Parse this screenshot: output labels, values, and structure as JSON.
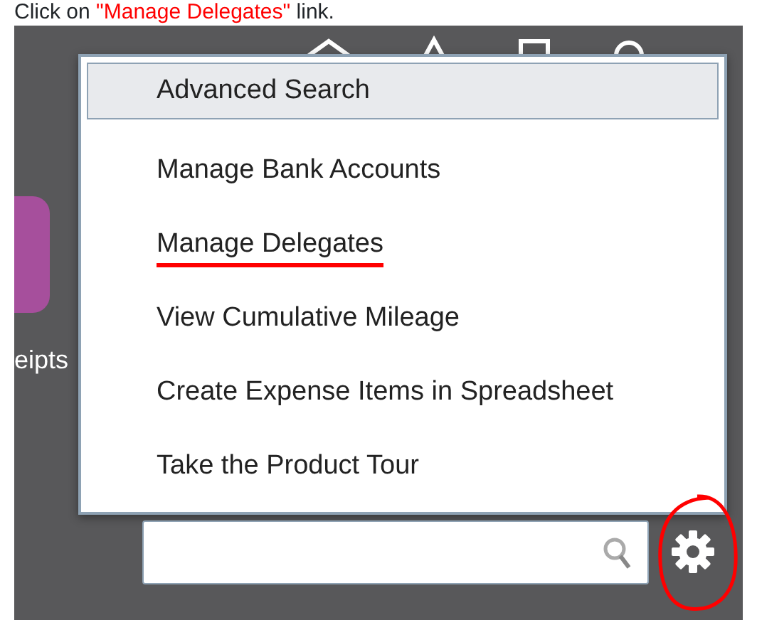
{
  "instruction": [
    {
      "text": "Click on ",
      "kind": "plain"
    },
    {
      "text": "\"Manage Delegates\"",
      "kind": "highlight"
    },
    {
      "text": " link.",
      "kind": "plain"
    }
  ],
  "tile": {
    "label": "eipts"
  },
  "menu": {
    "items": [
      {
        "label": "Advanced Search",
        "selected": true,
        "annotated": false
      },
      {
        "label": "Manage Bank Accounts",
        "selected": false,
        "annotated": false
      },
      {
        "label": "Manage Delegates",
        "selected": false,
        "annotated": true
      },
      {
        "label": "View Cumulative Mileage",
        "selected": false,
        "annotated": false
      },
      {
        "label": "Create Expense Items in Spreadsheet",
        "selected": false,
        "annotated": false
      },
      {
        "label": "Take the Product Tour",
        "selected": false,
        "annotated": false
      }
    ]
  },
  "settings": {
    "annotated": true
  }
}
